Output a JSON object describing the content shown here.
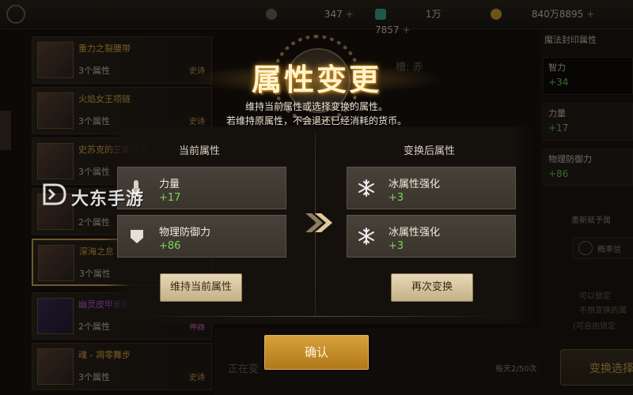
{
  "currencies": [
    {
      "name": "gear-currency",
      "value": "347",
      "plus": "+"
    },
    {
      "name": "gem-currency",
      "value": "1万7857",
      "plus": "+"
    },
    {
      "name": "gold-currency",
      "value": "840万8895",
      "plus": "+"
    }
  ],
  "left_list": {
    "items": [
      {
        "name": "重力之裂腰带",
        "count": "3个属性",
        "tag": "史诗"
      },
      {
        "name": "火焰女王项链",
        "count": "3个属性",
        "tag": "史诗"
      },
      {
        "name": "史苏克的三滴眼泪",
        "count": "3个属性",
        "tag": "史诗"
      },
      {
        "name": "",
        "count": "2个属性",
        "tag": ""
      },
      {
        "name": "深海之息",
        "count": "3个属性",
        "tag": ""
      },
      {
        "name": "幽灵皮甲长靴",
        "count": "2个属性",
        "tag": "神器"
      },
      {
        "name": "魂 - 凋零舞步",
        "count": "3个属性",
        "tag": "史诗"
      }
    ]
  },
  "right_panel": {
    "title": "魔法封印属性",
    "boxes": [
      {
        "label": "智力",
        "value": "+34"
      },
      {
        "label": "力量",
        "value": "+17"
      },
      {
        "label": "物理防御力",
        "value": "+86"
      }
    ],
    "refresh_label": "重新赋予属",
    "inline_button": "概率信",
    "notes": [
      "可以锁定",
      "不想变换的属",
      "（可自由锁定"
    ],
    "transfer_button": "变换选择",
    "daily_limit": "每天2/50次"
  },
  "bottom_strip": {
    "text": "正在变"
  },
  "background_extra": "槽: 赤",
  "modal": {
    "title": "属性变更",
    "description_line1": "维持当前属性或选择变换的属性。",
    "description_line2": "若维持原属性，不会退还已经消耗的货币。",
    "current_header": "当前属性",
    "changed_header": "变换后属性",
    "current_attrs": [
      {
        "name": "力量",
        "value": "+17",
        "icon": "strength-icon"
      },
      {
        "name": "物理防御力",
        "value": "+86",
        "icon": "shield-icon"
      }
    ],
    "changed_attrs": [
      {
        "name": "冰属性强化",
        "value": "+3",
        "icon": "snowflake-icon"
      },
      {
        "name": "冰属性强化",
        "value": "+3",
        "icon": "snowflake-icon"
      }
    ],
    "keep_button": "维持当前属性",
    "again_button": "再次变换",
    "confirm_button": "确认"
  },
  "watermark": "大东手游",
  "colors": {
    "accent_gold": "#d8a23e",
    "value_green": "#7ed45c",
    "title_glow": "#d49a2c"
  }
}
